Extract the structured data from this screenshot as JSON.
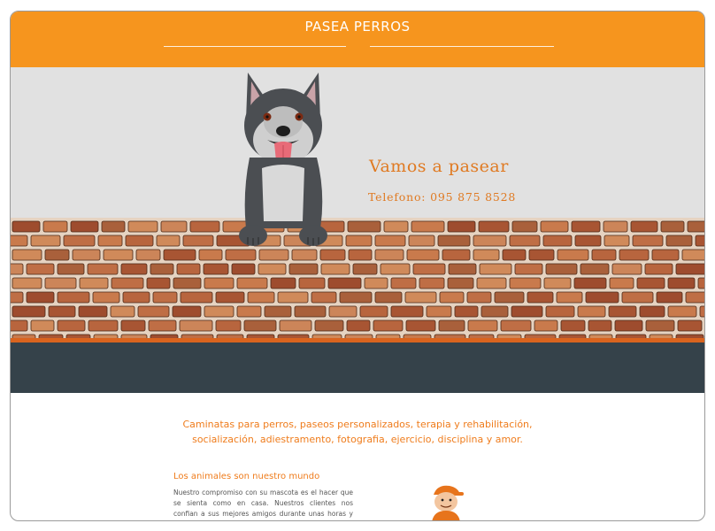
{
  "header": {
    "title": "PASEA PERROS"
  },
  "hero": {
    "tagline": "Vamos a pasear",
    "phone": "Telefono: 095 875 8528"
  },
  "services": {
    "line1": "Caminatas para perros, paseos personalizados, terapia y rehabilitación,",
    "line2": "socialización, adiestramento, fotografia, ejercicio, disciplina y amor."
  },
  "about": {
    "title": "Los animales son nuestro mundo",
    "text": "Nuestro compromiso con su mascota es el hacer que se sienta como en casa. Nuestros clientes nos confian a sus mejores amigos durante unas horas y nosotros les"
  },
  "colors": {
    "accent_orange": "#f6951e",
    "text_orange": "#ef7c1c",
    "dark_band": "#35424a",
    "hero_bg": "#e1e1e1"
  },
  "icons": {
    "hero_illustration": "dog-on-wall-illustration",
    "mascot": "walker-boy-icon"
  }
}
